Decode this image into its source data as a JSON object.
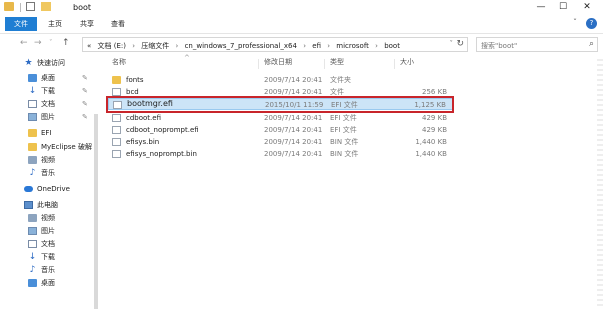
{
  "window": {
    "title": "boot",
    "minimize": "—",
    "maximize": "☐",
    "close": "✕"
  },
  "ribbon": {
    "tabs": [
      "文件",
      "主页",
      "共享",
      "查看"
    ],
    "expand": "ˇ",
    "help": "?"
  },
  "address": {
    "nav_back": "←",
    "nav_forward": "→",
    "nav_recent": "ˇ",
    "nav_up": "↑",
    "crumbs": [
      "«",
      "文档 (E:)",
      "压缩文件",
      "cn_windows_7_professional_x64",
      "efi",
      "microsoft",
      "boot"
    ],
    "separator": "›",
    "dropdown": "ˇ",
    "refresh": "↻",
    "search_placeholder": "搜索\"boot\"",
    "search_icon": "⌕"
  },
  "nav": {
    "items": [
      {
        "label": "快速访问",
        "icon": "star-icon",
        "pinned": false
      },
      {
        "label": "桌面",
        "icon": "desktop-icon",
        "pinned": true
      },
      {
        "label": "下载",
        "icon": "download-icon",
        "pinned": true
      },
      {
        "label": "文档",
        "icon": "document-icon",
        "pinned": true
      },
      {
        "label": "图片",
        "icon": "picture-icon",
        "pinned": true
      },
      {
        "label": "EFI",
        "icon": "folder-icon",
        "pinned": false
      },
      {
        "label": "MyEclipse 破解",
        "icon": "folder-icon",
        "pinned": false
      },
      {
        "label": "视频",
        "icon": "video-icon",
        "pinned": false
      },
      {
        "label": "音乐",
        "icon": "music-icon",
        "pinned": false
      },
      {
        "label": "OneDrive",
        "icon": "cloud-icon",
        "pinned": false
      },
      {
        "label": "此电脑",
        "icon": "pc-icon",
        "pinned": false
      },
      {
        "label": "视频",
        "icon": "video-icon",
        "pinned": false
      },
      {
        "label": "图片",
        "icon": "picture-icon",
        "pinned": false
      },
      {
        "label": "文档",
        "icon": "document-icon",
        "pinned": false
      },
      {
        "label": "下载",
        "icon": "download-icon",
        "pinned": false
      },
      {
        "label": "音乐",
        "icon": "music-icon",
        "pinned": false
      },
      {
        "label": "桌面",
        "icon": "desktop-icon",
        "pinned": false
      }
    ],
    "pin_glyph": "✎"
  },
  "files": {
    "columns": {
      "name": "名称",
      "date": "修改日期",
      "type": "类型",
      "size": "大小"
    },
    "sort_indicator": "^",
    "rows": [
      {
        "name": "fonts",
        "date": "2009/7/14 20:41",
        "type": "文件夹",
        "size": "",
        "kind": "folder",
        "selected": false
      },
      {
        "name": "bcd",
        "date": "2009/7/14 20:41",
        "type": "文件",
        "size": "256 KB",
        "kind": "file",
        "selected": false
      },
      {
        "name": "bootmgr.efi",
        "date": "2015/10/1 11:59",
        "type": "EFI 文件",
        "size": "1,125 KB",
        "kind": "file",
        "selected": true
      },
      {
        "name": "cdboot.efi",
        "date": "2009/7/14 20:41",
        "type": "EFI 文件",
        "size": "429 KB",
        "kind": "file",
        "selected": false
      },
      {
        "name": "cdboot_noprompt.efi",
        "date": "2009/7/14 20:41",
        "type": "EFI 文件",
        "size": "429 KB",
        "kind": "file",
        "selected": false
      },
      {
        "name": "efisys.bin",
        "date": "2009/7/14 20:41",
        "type": "BIN 文件",
        "size": "1,440 KB",
        "kind": "file",
        "selected": false
      },
      {
        "name": "efisys_noprompt.bin",
        "date": "2009/7/14 20:41",
        "type": "BIN 文件",
        "size": "1,440 KB",
        "kind": "file",
        "selected": false
      }
    ]
  },
  "colors": {
    "accent": "#1f7ed3",
    "selection": "#cce4f7",
    "highlight_border": "#c8252b",
    "folder": "#eec24d"
  }
}
